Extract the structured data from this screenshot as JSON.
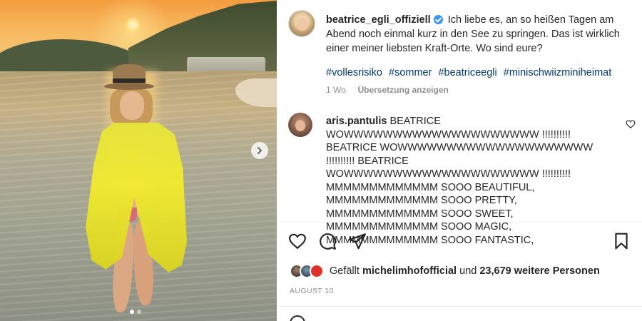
{
  "post": {
    "username": "beatrice_egli_offiziell",
    "caption": "Ich liebe es, an so heißen Tagen am Abend noch einmal kurz in den See zu springen. Das ist wirklich einer meiner liebsten Kraft-Orte. Wo sind eure?",
    "hashtags": [
      "#vollesrisiko",
      "#sommer",
      "#beatriceegli",
      "#minischwiizminiheimat"
    ],
    "age": "1 Wo.",
    "translate_label": "Übersetzung anzeigen"
  },
  "comment": {
    "username": "aris.pantulis",
    "text": "BEATRICE WOWWWWWWWWWWWWWWWWWWWW !!!!!!!!!! BEATRICE WOWWWWWWWWWWWWWWWWWWWW !!!!!!!!!! BEATRICE WOWWWWWWWWWWWWWWWWWWWW !!!!!!!!!! MMMMMMMMMMMMM SOOO BEAUTIFUL, MMMMMMMMMMMMM SOOO PRETTY, MMMMMMMMMMMMM SOOO SWEET, MMMMMMMMMMMMM SOOO MAGIC, MMMMMMMMMMMMM SOOO FANTASTIC,"
  },
  "likes": {
    "prefix": "Gefällt",
    "liker": "michelimhofofficial",
    "connector": "und",
    "count": "23,679 weitere Personen"
  },
  "date": "AUGUST 10",
  "icons": {
    "like": "heart-icon",
    "comment": "comment-icon",
    "share": "send-icon",
    "save": "bookmark-icon",
    "next": "chevron-right-icon",
    "comment_like": "heart-icon"
  },
  "colors": {
    "link": "#00376b",
    "verified": "#3897f0",
    "muted": "#8e8e8e",
    "text": "#262626"
  },
  "carousel": {
    "slides": 2,
    "active": 1
  }
}
